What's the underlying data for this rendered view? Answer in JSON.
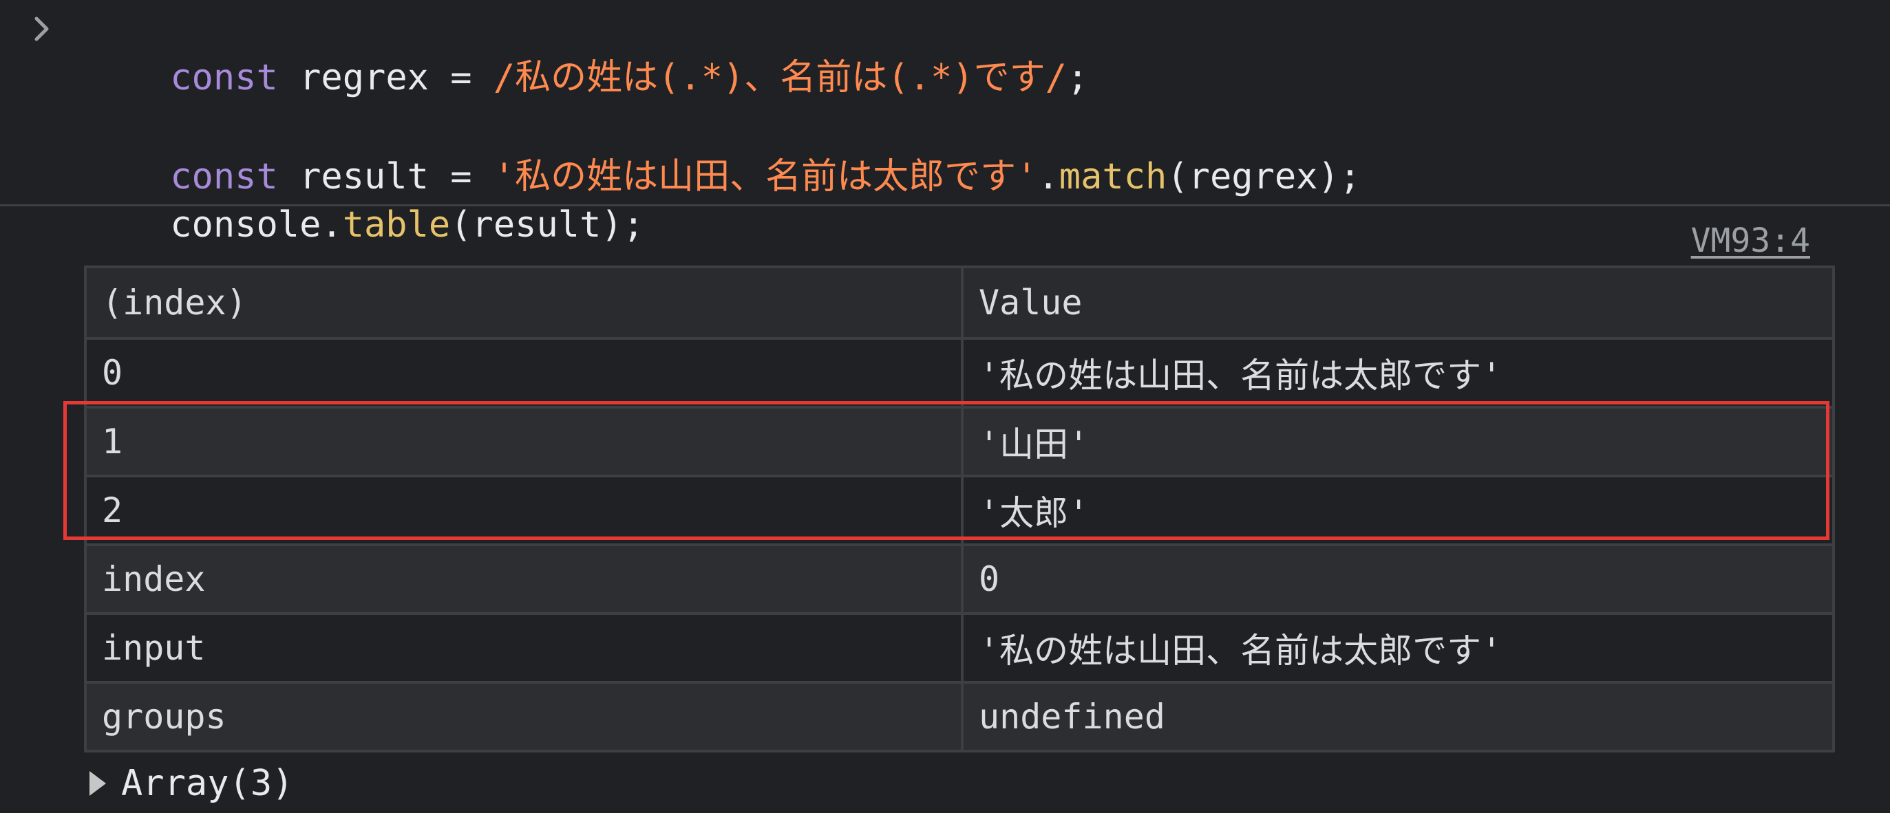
{
  "input": {
    "lines": [
      {
        "tokens": [
          {
            "text": "const",
            "kind": "kw"
          },
          {
            "text": " regrex = ",
            "kind": "plain"
          },
          {
            "text": "/私の姓は(.*)、名前は(.*)です/",
            "kind": "str"
          },
          {
            "text": ";",
            "kind": "plain"
          }
        ]
      },
      {
        "tokens": [
          {
            "text": "const",
            "kind": "kw"
          },
          {
            "text": " result = ",
            "kind": "plain"
          },
          {
            "text": "'私の姓は山田、名前は太郎です'",
            "kind": "str"
          },
          {
            "text": ".",
            "kind": "plain"
          },
          {
            "text": "match",
            "kind": "fn"
          },
          {
            "text": "(regrex);",
            "kind": "plain"
          }
        ]
      },
      {
        "tokens": [
          {
            "text": "console.",
            "kind": "plain"
          },
          {
            "text": "table",
            "kind": "fn"
          },
          {
            "text": "(result);",
            "kind": "plain"
          }
        ]
      }
    ],
    "prompt_icon": "chevron-right-icon"
  },
  "output": {
    "source_link": "VM93:4",
    "table": {
      "headers": [
        "(index)",
        "Value"
      ],
      "rows": [
        {
          "index": "0",
          "value": "'私の姓は山田、名前は太郎です'",
          "type": "string"
        },
        {
          "index": "1",
          "value": "'山田'",
          "type": "string"
        },
        {
          "index": "2",
          "value": "'太郎'",
          "type": "string"
        },
        {
          "index": "index",
          "value": "0",
          "type": "number"
        },
        {
          "index": "input",
          "value": "'私の姓は山田、名前は太郎です'",
          "type": "string"
        },
        {
          "index": "groups",
          "value": "undefined",
          "type": "undefined"
        }
      ]
    },
    "array_summary": "Array(3)",
    "expand_icon": "triangle-right-icon"
  },
  "colors": {
    "background": "#202124",
    "keyword": "#a78bda",
    "string_literal": "#ff8a50",
    "function": "#e6c36a",
    "string_value": "#32d3c3",
    "number_value": "#a28ef6",
    "undefined_value": "#80868b",
    "highlight_border": "#e53935"
  }
}
